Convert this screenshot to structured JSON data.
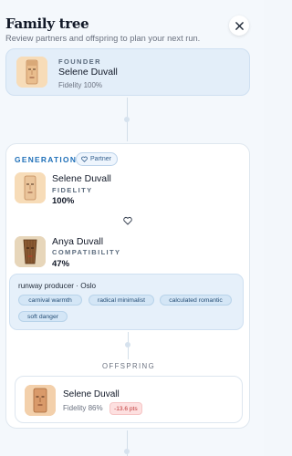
{
  "header": {
    "title": "Family tree",
    "subtitle": "Review partners and offspring to plan your next run."
  },
  "founder": {
    "kicker": "FOUNDER",
    "name": "Selene Duvall",
    "stat": "Fidelity 100%"
  },
  "generation": {
    "label": "GENERATION 1",
    "badge": "Partner",
    "primary": {
      "name": "Selene Duvall",
      "stat_label": "FIDELITY",
      "stat_value": "100%"
    },
    "partner": {
      "name": "Anya Duvall",
      "stat_label": "COMPATIBILITY",
      "stat_value": "47%"
    },
    "traits": {
      "headline": "runway producer · Oslo",
      "tags": [
        "carnival warmth",
        "radical minimalist",
        "calculated romantic",
        "soft danger"
      ]
    },
    "offspring": {
      "label": "OFFSPRING",
      "name": "Selene Duvall",
      "stat": "Fidelity 86%",
      "delta": "-13.6 pts"
    }
  },
  "icons": [
    "close-icon",
    "heart-icon",
    "portrait-icon",
    "mask-icon"
  ],
  "colors": {
    "accent": "#1e6fb8",
    "card_tint": "#e3eef9",
    "negative": "#c03a3a"
  }
}
